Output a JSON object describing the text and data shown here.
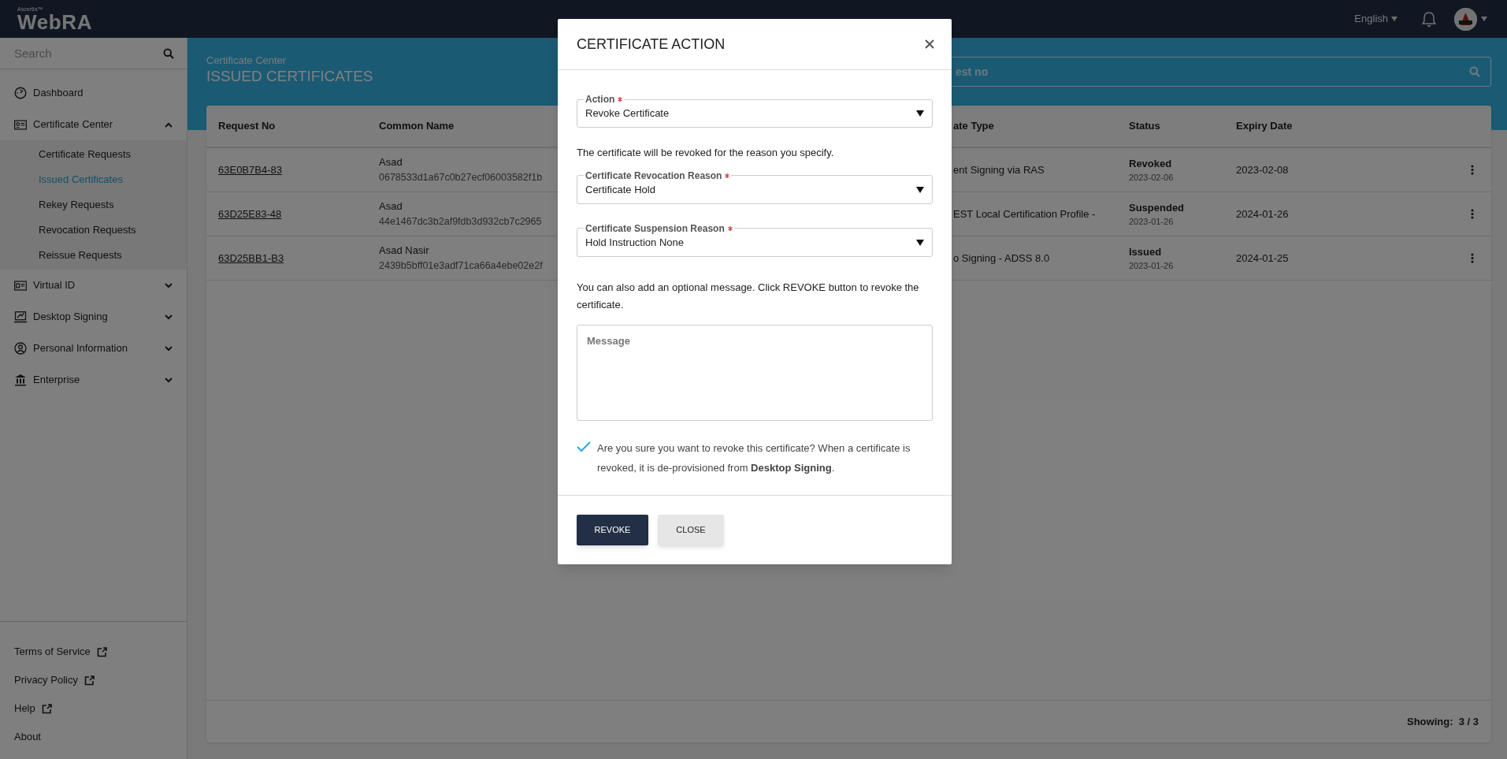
{
  "app": {
    "brand_small": "Ascertia™",
    "brand": "WebRA",
    "language": "English"
  },
  "sidebar": {
    "search_placeholder": "Search",
    "items": [
      {
        "label": "Dashboard"
      },
      {
        "label": "Certificate Center",
        "expanded": true,
        "children": [
          {
            "label": "Certificate Requests",
            "selected": false
          },
          {
            "label": "Issued Certificates",
            "selected": true
          },
          {
            "label": "Rekey Requests",
            "selected": false
          },
          {
            "label": "Revocation Requests",
            "selected": false
          },
          {
            "label": "Reissue Requests",
            "selected": false
          }
        ]
      },
      {
        "label": "Virtual ID",
        "expanded": false
      },
      {
        "label": "Desktop Signing",
        "expanded": false
      },
      {
        "label": "Personal Information",
        "expanded": false
      },
      {
        "label": "Enterprise",
        "expanded": false
      }
    ],
    "footer_links": [
      {
        "label": "Terms of Service",
        "external": true
      },
      {
        "label": "Privacy Policy",
        "external": true
      },
      {
        "label": "Help",
        "external": true
      },
      {
        "label": "About",
        "external": false
      }
    ]
  },
  "page_header": {
    "breadcrumb": "Certificate Center",
    "title": "ISSUED CERTIFICATES",
    "search_placeholder": "est no"
  },
  "table": {
    "columns": [
      "Request No",
      "Common Name",
      "ate Type",
      "Status",
      "Expiry Date"
    ],
    "rows": [
      {
        "request_no": "63E0B7B4-83",
        "common_name": "Asad",
        "common_name_id": "0678533d1a67c0b27ecf06003582f1b",
        "column_3": "ent Signing via RAS",
        "status": "Revoked",
        "status_date": "2023-02-06",
        "expiry_date": "2023-02-08"
      },
      {
        "request_no": "63D25E83-48",
        "common_name": "Asad",
        "common_name_id": "44e1467dc3b2af9fdb3d932cb7c2965",
        "column_3": "EST Local Certification Profile -",
        "status": "Suspended",
        "status_date": "2023-01-26",
        "expiry_date": "2024-01-26"
      },
      {
        "request_no": "63D25BB1-B3",
        "common_name": "Asad Nasir",
        "common_name_id": "2439b5bff01e3adf71ca66a4ebe02e2f",
        "column_3": "o Signing - ADSS 8.0",
        "status": "Issued",
        "status_date": "2023-01-26",
        "expiry_date": "2024-01-25"
      }
    ],
    "footer": "Showing:  3 / 3"
  },
  "modal": {
    "title": "CERTIFICATE ACTION",
    "fields": [
      {
        "label": "Action",
        "required": true,
        "value": "Revoke Certificate"
      },
      {
        "label": "Certificate Revocation Reason",
        "required": true,
        "value": "Certificate Hold"
      },
      {
        "label": "Certificate Suspension Reason",
        "required": true,
        "value": "Hold Instruction None"
      }
    ],
    "reason_note": "The certificate will be revoked for the reason you specify.",
    "message_note": "You can also add an optional message. Click REVOKE button to revoke the certificate.",
    "message_placeholder": "Message",
    "confirm": {
      "checked": true,
      "text": "Are you sure you want to revoke this certificate? When a certificate is revoked, it is de-provisioned from **Desktop Signing**."
    },
    "buttons": [
      {
        "label": "REVOKE",
        "kind": "primary"
      },
      {
        "label": "CLOSE",
        "kind": "secondary"
      }
    ]
  }
}
